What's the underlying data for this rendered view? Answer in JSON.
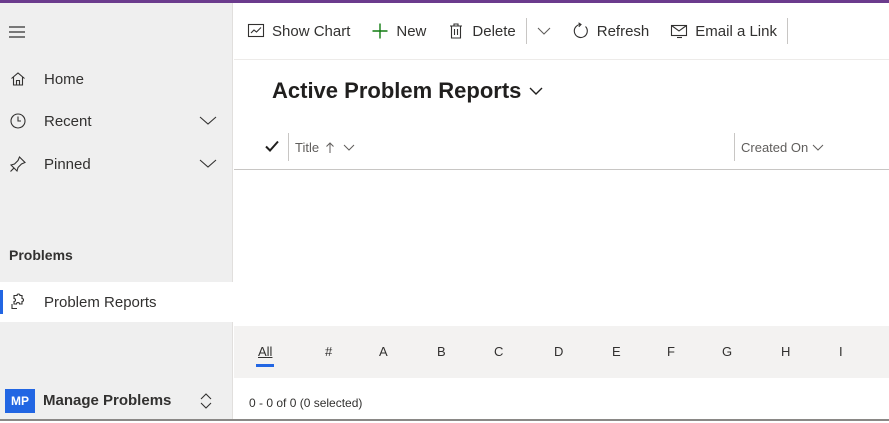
{
  "colors": {
    "accent": "#6b3b8d",
    "accent_blue": "#2266e3",
    "new_icon_green": "#107c10"
  },
  "sidebar": {
    "items": [
      {
        "label": "Home",
        "icon": "home-icon"
      },
      {
        "label": "Recent",
        "icon": "clock-icon"
      },
      {
        "label": "Pinned",
        "icon": "pin-icon"
      }
    ],
    "section_title": "Problems",
    "entities": [
      {
        "label": "Problem Reports",
        "icon": "puzzle-icon",
        "selected": true
      }
    ],
    "area": {
      "badge": "MP",
      "label": "Manage Problems"
    }
  },
  "commandbar": {
    "show_chart": "Show Chart",
    "new": "New",
    "delete": "Delete",
    "refresh": "Refresh",
    "email_link": "Email a Link"
  },
  "view": {
    "title": "Active Problem Reports"
  },
  "grid": {
    "columns": [
      "Title",
      "Created On"
    ],
    "rows": [],
    "jump_letters": [
      "All",
      "#",
      "A",
      "B",
      "C",
      "D",
      "E",
      "F",
      "G",
      "H",
      "I"
    ],
    "active_jump": "All",
    "status": "0 - 0 of 0 (0 selected)"
  }
}
